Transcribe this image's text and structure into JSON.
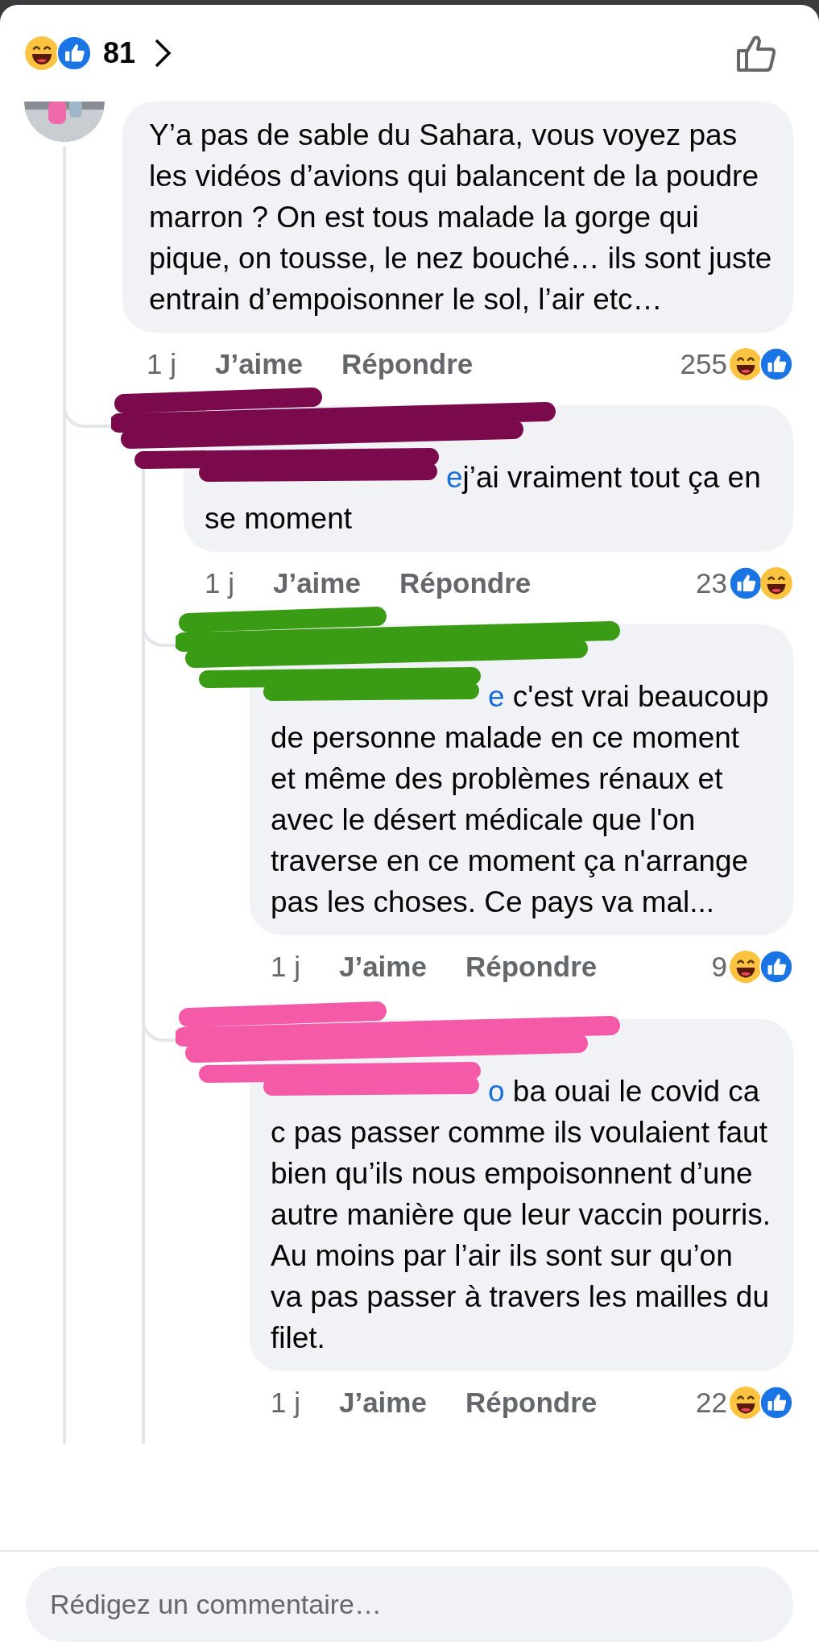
{
  "header": {
    "reactions": [
      {
        "kind": "haha"
      },
      {
        "kind": "like"
      }
    ],
    "count": "81"
  },
  "comments": [
    {
      "avatar": {
        "kind": "picture"
      },
      "text": "Y’a pas de sable du Sahara, vous voyez pas les vidéos d’avions qui balancent de la poudre marron ? On est tous malade la gorge qui pique, on tousse, le nez bouché… ils sont juste entrain d’empoisonner le sol, l’air etc…",
      "time": "1 j",
      "like": "J’aime",
      "reply": "Répondre",
      "reaction_count": "255",
      "reactions": [
        {
          "kind": "haha"
        },
        {
          "kind": "like"
        }
      ],
      "children": [
        {
          "redaction": {
            "color": "#7a0a4c"
          },
          "mention": "e",
          "text": "j’ai vraiment tout ça en se moment",
          "time": "1 j",
          "like": "J’aime",
          "reply": "Répondre",
          "reaction_count": "23",
          "reactions": [
            {
              "kind": "like"
            },
            {
              "kind": "haha"
            }
          ],
          "children": [
            {
              "redaction": {
                "color": "#3a9c14"
              },
              "mention": "e",
              "text": " c'est vrai beaucoup de personne malade en ce moment et même des problèmes rénaux et avec le désert médicale que l'on traverse en ce moment ça n'arrange pas les choses. Ce pays va mal...",
              "time": "1 j",
              "like": "J’aime",
              "reply": "Répondre",
              "reaction_count": "9",
              "reactions": [
                {
                  "kind": "haha"
                },
                {
                  "kind": "like"
                }
              ]
            },
            {
              "redaction": {
                "color": "#f55aa8"
              },
              "mention": "o",
              "text": " ba ouai le covid ca c pas passer comme ils voulaient faut bien qu’ils nous empoisonnent d’une autre manière que leur vaccin pourris. Au moins par l’air ils sont sur qu’on va pas passer à travers les mailles du filet.",
              "time": "1 j",
              "like": "J’aime",
              "reply": "Répondre",
              "reaction_count": "22",
              "reactions": [
                {
                  "kind": "haha"
                },
                {
                  "kind": "like"
                }
              ]
            }
          ]
        }
      ]
    }
  ],
  "composer": {
    "placeholder": "Rédigez un commentaire…"
  }
}
